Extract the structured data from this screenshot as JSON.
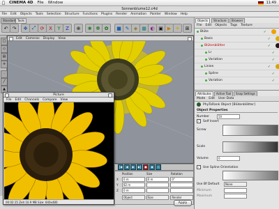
{
  "menubar": {
    "items": [
      "CINEMA 4D",
      "File",
      "Window"
    ],
    "clock": "11:49"
  },
  "window": {
    "title": "Sonnenblume12.c4d"
  },
  "appmenu": [
    "File",
    "Edit",
    "Objects",
    "Tools",
    "Selection",
    "Structure",
    "Functions",
    "Plugins",
    "Render",
    "Animation",
    "Painter",
    "Window",
    "Help"
  ],
  "toolbar": {
    "tabs": [
      "Standard",
      "Tools"
    ]
  },
  "viewport": {
    "menu": [
      "Edit",
      "Cameras",
      "Display",
      "View"
    ],
    "label": "View"
  },
  "picture_viewer": {
    "title": "Picture",
    "menu": [
      "File",
      "Edit",
      "Channels",
      "Compare",
      "View"
    ],
    "status": "00:02:15   Zeit 10.9 MB  Size: 640x480"
  },
  "coords": {
    "headers": [
      "Position",
      "Size",
      "Rotation"
    ],
    "rows": [
      {
        "axis": "X",
        "pos": "0 m",
        "size": "0 m",
        "rot": "0°"
      },
      {
        "axis": "Y",
        "pos": "82 m",
        "size": "",
        "rot": ""
      },
      {
        "axis": "Z",
        "pos": "0 m",
        "size": "",
        "rot": ""
      }
    ],
    "dropdowns": [
      "Object",
      "Size",
      "Render"
    ],
    "apply": "Apply"
  },
  "objects": {
    "tabs": [
      "Objects",
      "Structure",
      "Browser"
    ],
    "menu": [
      "File",
      "Edit",
      "Objects",
      "Tags",
      "Texture"
    ],
    "rows": [
      {
        "name": "Blüte",
        "indent": 0,
        "red": false,
        "color": "#f0a000"
      },
      {
        "name": "Basis",
        "indent": 1,
        "red": false,
        "color": "#d8b000"
      },
      {
        "name": "Blütenblätter",
        "indent": 1,
        "red": true,
        "color": "#1a1a1a"
      },
      {
        "name": "Lr",
        "indent": 2,
        "red": false,
        "color": "#c0c0c0"
      },
      {
        "name": "Variation",
        "indent": 2,
        "red": false,
        "color": "#c0c0c0"
      },
      {
        "name": "Linien",
        "indent": 1,
        "red": false,
        "color": "#d4a500"
      },
      {
        "name": "Spline",
        "indent": 2,
        "red": false,
        "color": "#777777"
      },
      {
        "name": "Variation",
        "indent": 2,
        "red": false,
        "color": "#c0c0c0"
      }
    ]
  },
  "attributes": {
    "tabs": [
      "Attributes",
      "Active Tool",
      "Snap Settings"
    ],
    "menu": [
      "Mode",
      "Edit",
      "User Data"
    ],
    "object_title": "PhyToRank Object [Blütenblätter]",
    "section": "Object Properties",
    "number_label": "Number",
    "number_value": "50",
    "self_insert": "Self Insert",
    "screw_label": "Screw",
    "scale_label": "Scale",
    "volume_label": "Volume",
    "volume_value": "0",
    "use_spline": "Use Spline Orientation",
    "extra_label": "Use Bf Default",
    "extra_value": "None",
    "bottom_labels": [
      "Minimum",
      "Maximum"
    ]
  }
}
